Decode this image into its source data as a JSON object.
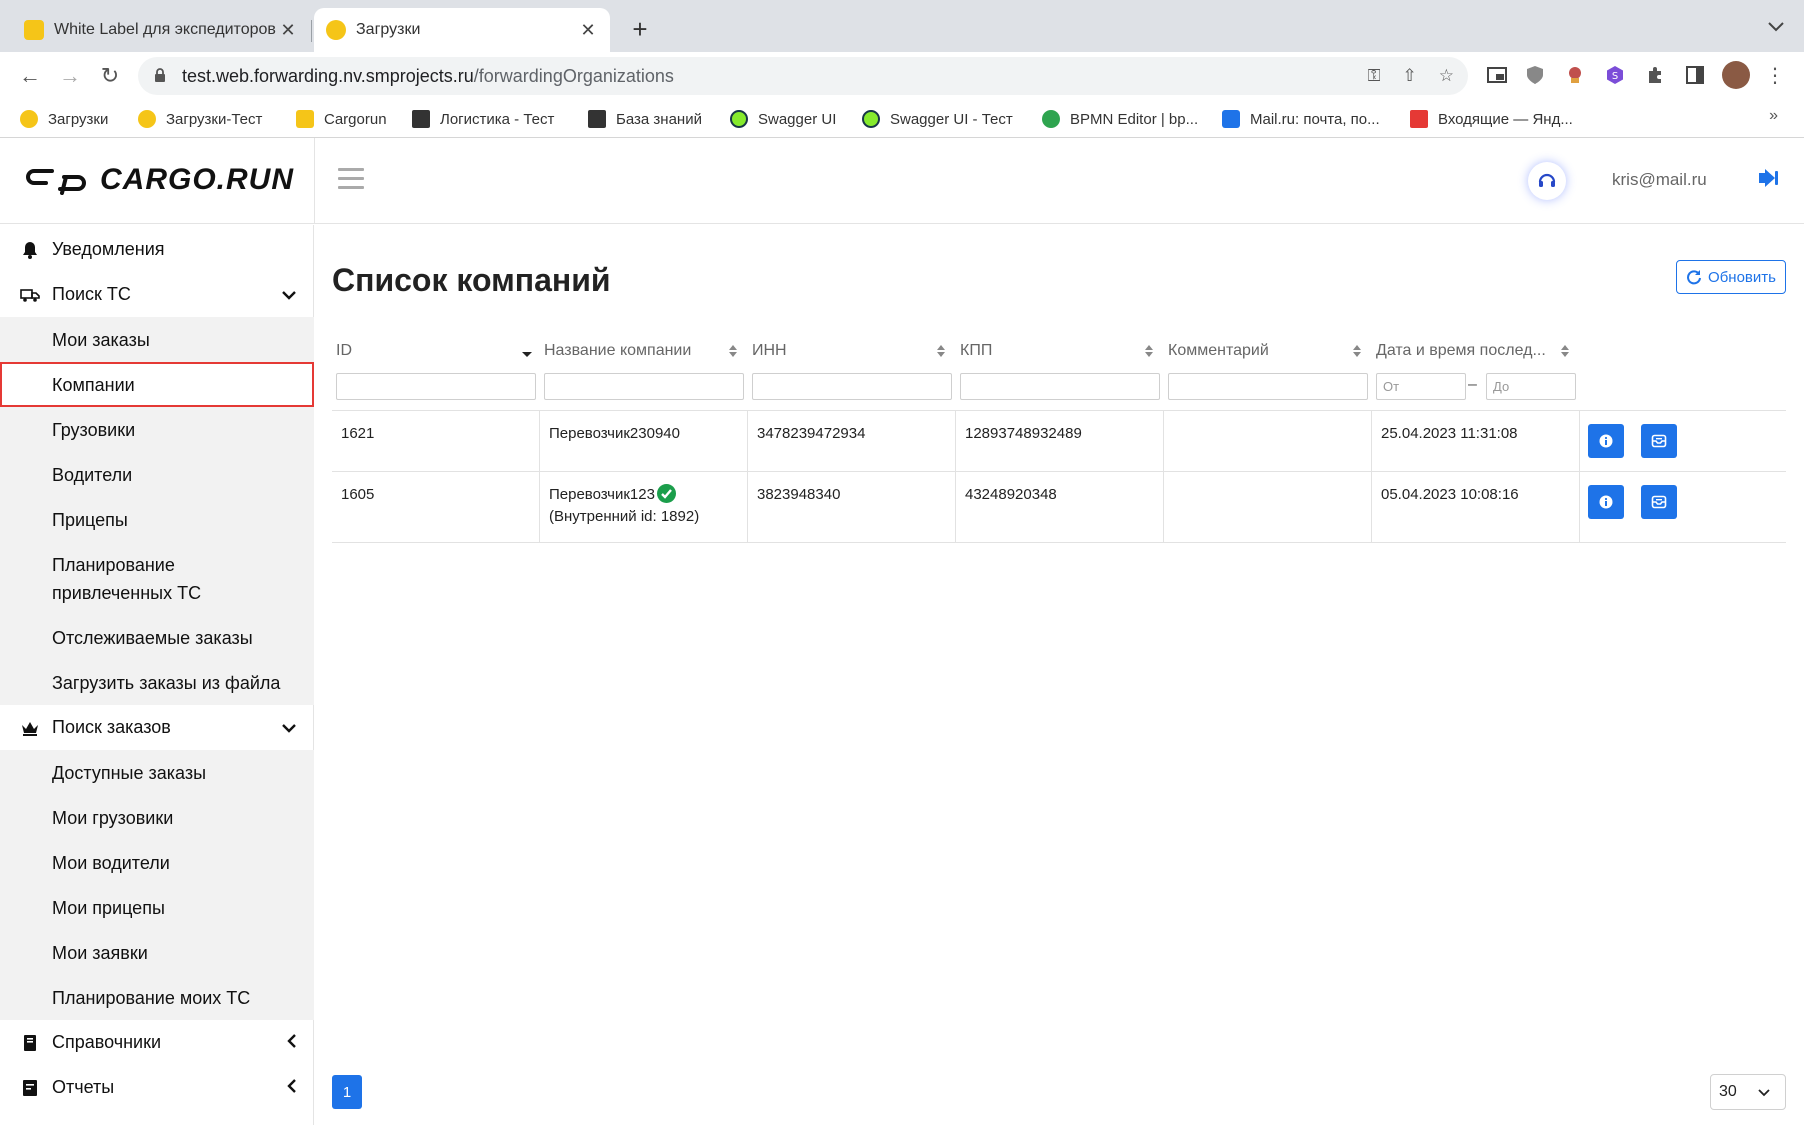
{
  "browser": {
    "tabs": [
      {
        "title": "White Label для экспедиторов",
        "active": false,
        "favicon_color": "#f5c518"
      },
      {
        "title": "Загрузки",
        "active": true,
        "favicon_color": "#f5c518"
      }
    ],
    "new_tab_label": "+",
    "url_host": "test.web.forwarding.nv.smprojects.ru",
    "url_path": "/forwardingOrganizations",
    "bookmarks": [
      {
        "label": "Загрузки",
        "icon_color": "#f5c518"
      },
      {
        "label": "Загрузки-Тест",
        "icon_color": "#f5c518"
      },
      {
        "label": "Cargorun",
        "icon_color": "#f5c518"
      },
      {
        "label": "Логистика - Тест",
        "icon_color": "#333333"
      },
      {
        "label": "База знаний",
        "icon_color": "#333333"
      },
      {
        "label": "Swagger UI",
        "icon_color": "#85ea2d"
      },
      {
        "label": "Swagger UI - Тест",
        "icon_color": "#85ea2d"
      },
      {
        "label": "BPMN Editor | bp...",
        "icon_color": "#2ea44f"
      },
      {
        "label": "Mail.ru: почта, по...",
        "icon_color": "#1e73e8"
      },
      {
        "label": "Входящие — Янд...",
        "icon_color": "#e53935"
      }
    ],
    "bookmarks_more": "»"
  },
  "header": {
    "logo_text": "CARGO.RUN",
    "user_email": "kris@mail.ru"
  },
  "sidebar": {
    "notifications": "Уведомления",
    "vehicle_search": {
      "label": "Поиск ТС",
      "items": [
        "Мои заказы",
        "Компании",
        "Грузовики",
        "Водители",
        "Прицепы",
        "Планирование привлеченных ТС",
        "Отслеживаемые заказы",
        "Загрузить заказы из файла"
      ],
      "selected": "Компании"
    },
    "order_search": {
      "label": "Поиск заказов",
      "items": [
        "Доступные заказы",
        "Мои грузовики",
        "Мои водители",
        "Мои прицепы",
        "Мои заявки",
        "Планирование моих ТС"
      ]
    },
    "directories": "Справочники",
    "reports": "Отчеты"
  },
  "main": {
    "title": "Список компаний",
    "refresh_label": "Обновить",
    "columns": [
      "ID",
      "Название компании",
      "ИНН",
      "КПП",
      "Комментарий",
      "Дата и время послед..."
    ],
    "date_from_placeholder": "От",
    "date_to_placeholder": "До",
    "rows": [
      {
        "id": "1621",
        "name": "Перевозчик230940",
        "internal": "",
        "verified": false,
        "inn": "3478239472934",
        "kpp": "12893748932489",
        "comment": "",
        "datetime": "25.04.2023 11:31:08"
      },
      {
        "id": "1605",
        "name": "Перевозчик123",
        "internal": "(Внутренний id: 1892)",
        "verified": true,
        "inn": "3823948340",
        "kpp": "43248920348",
        "comment": "",
        "datetime": "05.04.2023 10:08:16"
      }
    ],
    "current_page": "1",
    "page_size": "30"
  },
  "colors": {
    "accent": "#1e73e8",
    "selected_border": "#e53935",
    "verified": "#1b9e4b"
  }
}
